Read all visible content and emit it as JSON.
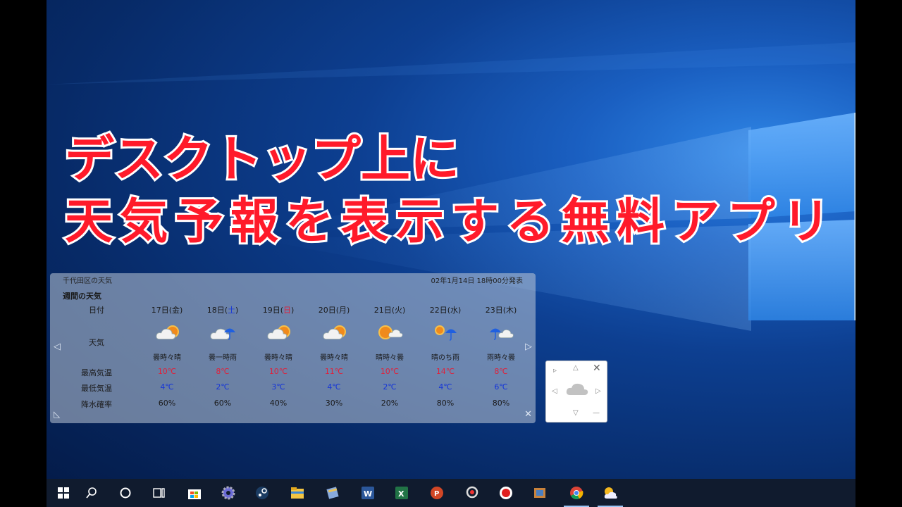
{
  "headline": {
    "line1": "デスクトップ上に",
    "line2": "天気予報を表示する無料アプリ"
  },
  "weather_widget": {
    "location": "千代田区の天気",
    "issued": "02年1月14日 18時00分発表",
    "week_title": "週間の天気",
    "labels": {
      "date": "日付",
      "weather": "天気",
      "high": "最高気温",
      "low": "最低気温",
      "rain": "降水確率"
    },
    "days": [
      {
        "date": "17日(",
        "dow": "金",
        "close": ")",
        "dow_color": "normal",
        "icon": "cloud-sun",
        "desc": "曇時々晴",
        "high": "10℃",
        "low": "4℃",
        "rain": "60%"
      },
      {
        "date": "18日(",
        "dow": "土",
        "close": ")",
        "dow_color": "sat",
        "icon": "cloud-umbrella",
        "desc": "曇一時雨",
        "high": "8℃",
        "low": "2℃",
        "rain": "60%"
      },
      {
        "date": "19日(",
        "dow": "日",
        "close": ")",
        "dow_color": "sun",
        "icon": "cloud-sun",
        "desc": "曇時々晴",
        "high": "10℃",
        "low": "3℃",
        "rain": "40%"
      },
      {
        "date": "20日(",
        "dow": "月",
        "close": ")",
        "dow_color": "normal",
        "icon": "cloud-sun",
        "desc": "曇時々晴",
        "high": "11℃",
        "low": "4℃",
        "rain": "30%"
      },
      {
        "date": "21日(",
        "dow": "火",
        "close": ")",
        "dow_color": "normal",
        "icon": "sun-cloud",
        "desc": "晴時々曇",
        "high": "10℃",
        "low": "2℃",
        "rain": "20%"
      },
      {
        "date": "22日(",
        "dow": "水",
        "close": ")",
        "dow_color": "normal",
        "icon": "sun-umbrella",
        "desc": "晴のち雨",
        "high": "14℃",
        "low": "4℃",
        "rain": "80%"
      },
      {
        "date": "23日(",
        "dow": "木",
        "close": ")",
        "dow_color": "normal",
        "icon": "umbrella-cloud",
        "desc": "雨時々曇",
        "high": "8℃",
        "low": "6℃",
        "rain": "80%"
      }
    ]
  },
  "mini_widget": {
    "icon": "cloud-icon"
  },
  "colors": {
    "high_temp": "#e0203a",
    "low_temp": "#1636d8",
    "headline_fill": "#ff1a2a"
  },
  "taskbar": {
    "items": [
      "windows-start-icon",
      "search-icon",
      "cortana-icon",
      "task-view-icon",
      "store-icon",
      "settings-gear-icon",
      "steam-icon",
      "file-explorer-icon",
      "notepad-icon",
      "word-icon",
      "excel-icon",
      "powerpoint-icon",
      "camera-app-icon",
      "record-icon",
      "video-editor-icon",
      "chrome-icon",
      "weather-app-icon"
    ]
  }
}
